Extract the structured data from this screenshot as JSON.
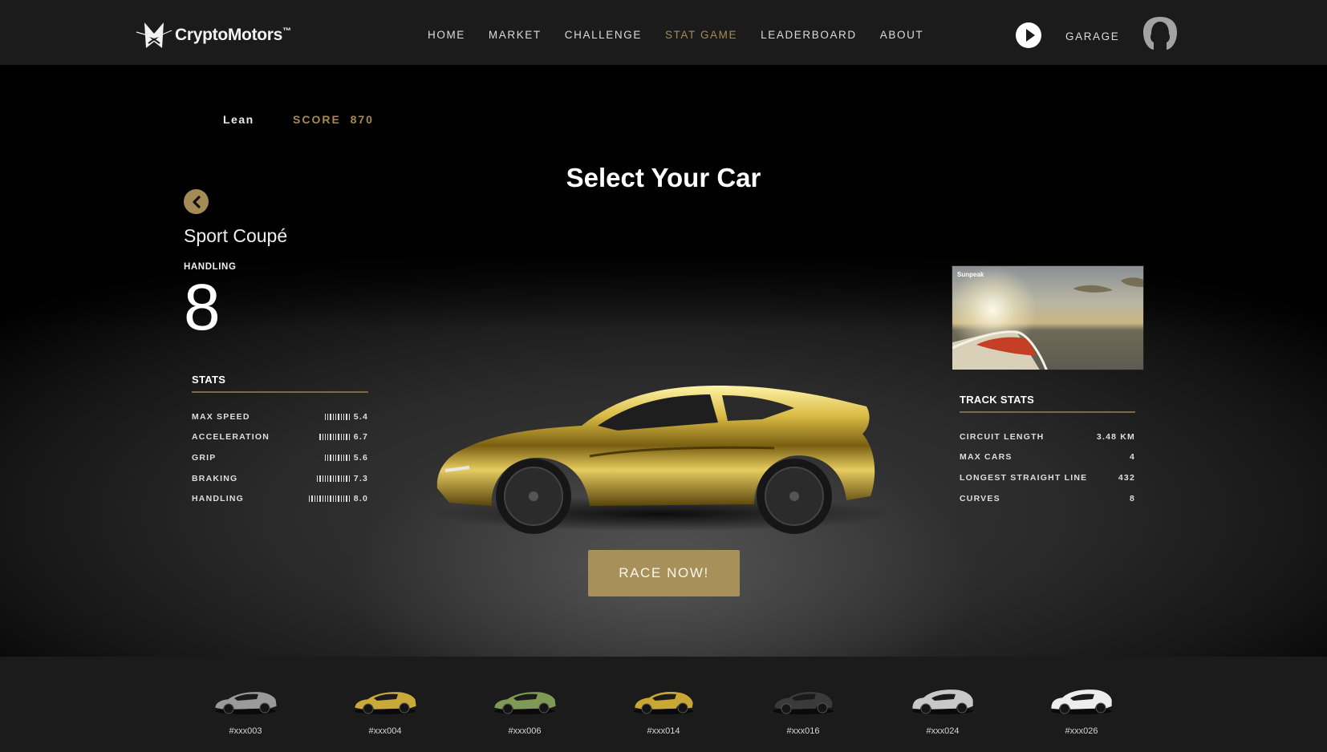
{
  "header": {
    "brand": "CryptoMotors",
    "brand_mark": "™",
    "nav": [
      {
        "label": "HOME",
        "active": false
      },
      {
        "label": "MARKET",
        "active": false
      },
      {
        "label": "CHALLENGE",
        "active": false
      },
      {
        "label": "STAT GAME",
        "active": true
      },
      {
        "label": "LEADERBOARD",
        "active": false
      },
      {
        "label": "ABOUT",
        "active": false
      }
    ],
    "play_icon": "play-circle-icon",
    "garage_label": "GARAGE",
    "avatar_icon": "user-silhouette-icon"
  },
  "player": {
    "name": "Lean",
    "score_label": "SCORE",
    "score_value": "870",
    "score_text": "SCORE  870"
  },
  "page_title": "Select Your Car",
  "car": {
    "back_icon": "chevron-left-icon",
    "type": "Sport Coupé",
    "focus_stat_label": "HANDLING",
    "focus_stat_value": "8",
    "stats_title": "STATS",
    "stats": [
      {
        "label": "MAX SPEED",
        "value": "5.4",
        "ticks": 10
      },
      {
        "label": "ACCELERATION",
        "value": "6.7",
        "ticks": 12
      },
      {
        "label": "GRIP",
        "value": "5.6",
        "ticks": 10
      },
      {
        "label": "BRAKING",
        "value": "7.3",
        "ticks": 13
      },
      {
        "label": "HANDLING",
        "value": "8.0",
        "ticks": 16
      }
    ],
    "color": "#c9a93a"
  },
  "track": {
    "name": "Sunpeak",
    "stats_title": "TRACK STATS",
    "stats": [
      {
        "label": "CIRCUIT LENGTH",
        "value": "3.48 KM"
      },
      {
        "label": "MAX CARS",
        "value": "4"
      },
      {
        "label": "LONGEST STRAIGHT LINE",
        "value": "432"
      },
      {
        "label": "CURVES",
        "value": "8"
      }
    ]
  },
  "race_button": "RACE NOW!",
  "garage_cars": [
    {
      "id": "#xxx003",
      "color": "#9a9a9a",
      "style": "coupe"
    },
    {
      "id": "#xxx004",
      "color": "#c9a93a",
      "style": "coupe"
    },
    {
      "id": "#xxx006",
      "color": "#7e9a55",
      "style": "coupe"
    },
    {
      "id": "#xxx014",
      "color": "#c8a735",
      "style": "hyper"
    },
    {
      "id": "#xxx016",
      "color": "#3a3a3a",
      "style": "hyper"
    },
    {
      "id": "#xxx024",
      "color": "#c8c8c8",
      "style": "suv"
    },
    {
      "id": "#xxx026",
      "color": "#ededed",
      "style": "suv"
    }
  ],
  "colors": {
    "accent": "#a48a54",
    "button": "#a8905a",
    "header_bg": "#1b1b1b"
  }
}
